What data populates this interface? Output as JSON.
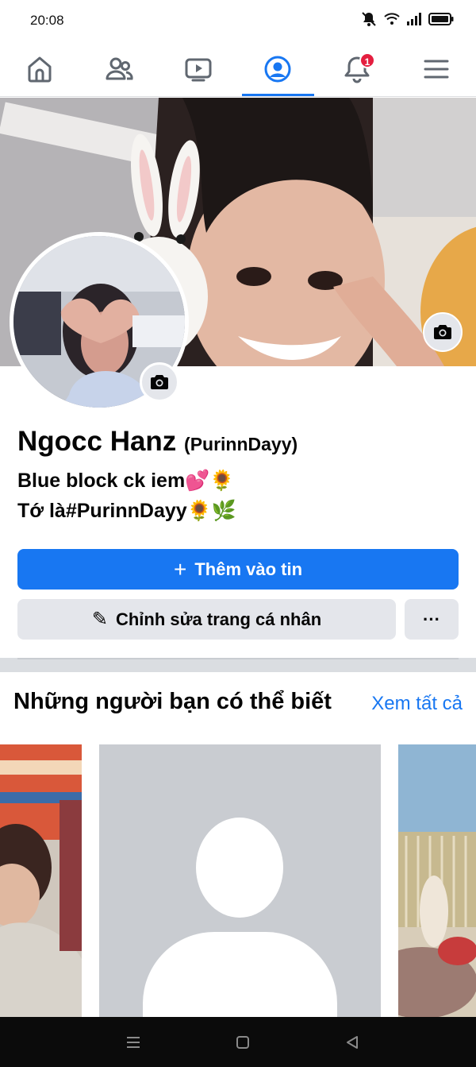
{
  "status_bar": {
    "time": "20:08",
    "icons": [
      "mute-icon",
      "wifi-icon",
      "signal-icon",
      "battery-icon"
    ]
  },
  "nav": {
    "items": [
      "home-icon",
      "friends-icon",
      "watch-icon",
      "profile-icon",
      "notifications-icon",
      "menu-icon"
    ],
    "active": "profile-icon",
    "notification_count": "1",
    "accent": "#1877f2",
    "badge_color": "#e41e3f"
  },
  "profile": {
    "name": "Ngocc Hanz",
    "alternate_name": "(PurinnDayy)",
    "bio_line_1": "Blue block ck iem💕🌻",
    "bio_line_2": "Tớ là#PurinnDayy🌻🌿"
  },
  "actions": {
    "add_to_story_icon": "+",
    "add_to_story": "Thêm vào tin",
    "edit_profile_icon": "✎",
    "edit_profile": "Chỉnh sửa trang cá nhân",
    "more": "···"
  },
  "people_you_may_know": {
    "title": "Những người bạn có thể biết",
    "see_all": "Xem tất cả",
    "cards": [
      "photo",
      "default-avatar",
      "photo"
    ]
  },
  "system_nav": {
    "buttons": [
      "recent-apps-icon",
      "home-circle-icon",
      "back-icon"
    ]
  }
}
